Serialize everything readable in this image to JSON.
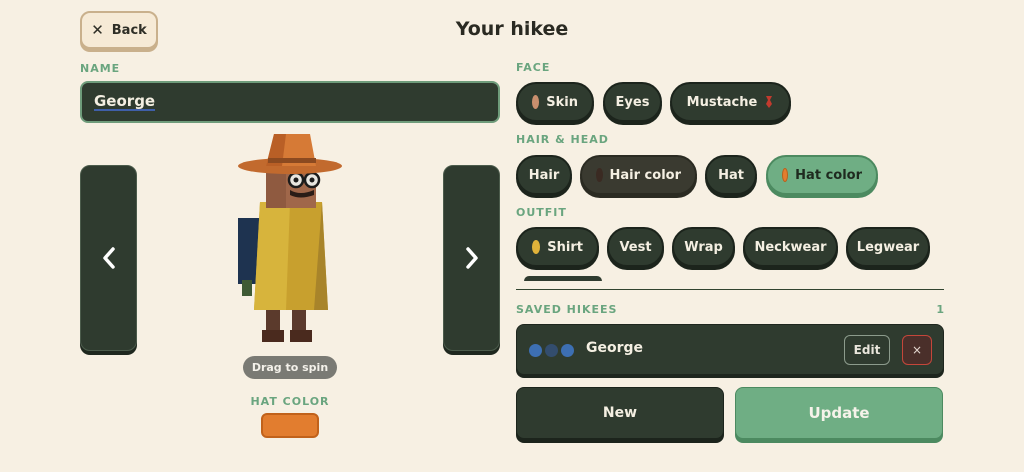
{
  "header": {
    "back_label": "Back",
    "back_icon": "close-icon",
    "title": "Your hikee"
  },
  "name": {
    "label": "NAME",
    "value": "George"
  },
  "preview": {
    "drag_hint": "Drag to spin",
    "hat_color_label": "HAT COLOR",
    "hat_color": "#e27d2f"
  },
  "face": {
    "label": "FACE",
    "chips": [
      {
        "label": "Skin",
        "swatch": "#c98f6e"
      },
      {
        "label": "Eyes"
      },
      {
        "label": "Mustache",
        "icon": "mustache-icon"
      }
    ]
  },
  "hair_head": {
    "label": "HAIR & HEAD",
    "chips": [
      {
        "label": "Hair"
      },
      {
        "label": "Hair color",
        "swatch": "#3a2a22"
      },
      {
        "label": "Hat"
      },
      {
        "label": "Hat color",
        "swatch": "#e27d2f",
        "active": true
      }
    ]
  },
  "outfit": {
    "label": "OUTFIT",
    "chips": [
      {
        "label": "Shirt",
        "swatch": "#e0b23a"
      },
      {
        "label": "Vest"
      },
      {
        "label": "Wrap"
      },
      {
        "label": "Neckwear"
      },
      {
        "label": "Legwear"
      }
    ]
  },
  "saved": {
    "label": "SAVED HIKEES",
    "count": "1",
    "items": [
      {
        "name": "George",
        "colors": [
          "#3d6fb3",
          "#334d6e",
          "#3d6fb3"
        ],
        "edit_label": "Edit",
        "delete_label": "×"
      }
    ]
  },
  "actions": {
    "new_label": "New",
    "update_label": "Update"
  },
  "colors": {
    "background": "#f7f0e3",
    "panel": "#2f3b2f",
    "accent": "#6fae84",
    "label": "#6aa57f"
  }
}
